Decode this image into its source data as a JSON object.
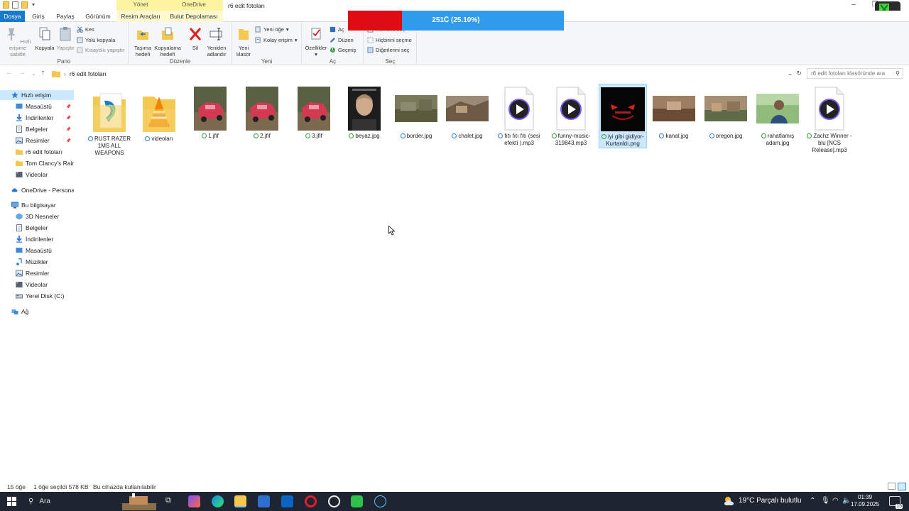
{
  "window": {
    "title": "r6 edit fotoları",
    "context_tabs": [
      "Yönet",
      "OneDrive"
    ],
    "context_sub_tabs": [
      "Resim Araçları",
      "Bulut Depolaması"
    ]
  },
  "tabs": [
    "Dosya",
    "Giriş",
    "Paylaş",
    "Görünüm"
  ],
  "ribbon": {
    "pano": {
      "label": "Pano",
      "pin": "Hızlı erişime sabitle",
      "copy": "Kopyala",
      "paste": "Yapıştır",
      "cut": "Kes",
      "copy_path": "Yolu kopyala",
      "paste_shortcut": "Kısayolu yapıştır"
    },
    "duzenle": {
      "label": "Düzenle",
      "move_to": "Taşıma hedefi",
      "copy_to": "Kopyalama hedefi",
      "delete": "Sil",
      "rename": "Yeniden adlandır"
    },
    "yeni": {
      "label": "Yeni",
      "new_folder": "Yeni klasör",
      "new_item": "Yeni öğe",
      "easy_access": "Kolay erişim"
    },
    "ac": {
      "label": "Aç",
      "properties": "Özellikler",
      "open": "Aç",
      "edit": "Düzen",
      "history": "Geçmiş"
    },
    "sec": {
      "label": "Seç",
      "select_all": "Tümünü seç",
      "select_none": "Hiçbirini seçme",
      "invert": "Diğerlerini seç"
    }
  },
  "overlay": {
    "text": "251Ꮯ (25.10%)",
    "progress": 0.251,
    "fill_color": "#e00c14",
    "bg_color": "#2f9bea"
  },
  "address": {
    "path": "r6 edit fotoları",
    "search_placeholder": "r6 edit fotoları klasöründe ara"
  },
  "nav": {
    "quick_access": "Hızlı erişim",
    "quick_items": [
      "Masaüstü",
      "İndirilenler",
      "Belgeler",
      "Resimler",
      "r6 edit fotoları",
      "Tom Clancy's Rainb",
      "Videolar"
    ],
    "onedrive": "OneDrive - Personal",
    "this_pc": "Bu bilgisayar",
    "pc_items": [
      "3D Nesneler",
      "Belgeler",
      "İndirilenler",
      "Masaüstü",
      "Müzikler",
      "Resimler",
      "Videolar",
      "Yerel Disk (C:)"
    ],
    "network": "Ağ"
  },
  "files": [
    {
      "name": "RUST RAZER 1MS ALL WEAPONS",
      "kind": "folder-app",
      "sync": "cloud"
    },
    {
      "name": "videoları",
      "kind": "folder-vlc",
      "sync": "cloud"
    },
    {
      "name": "1.jfif",
      "kind": "car",
      "sync": "ok"
    },
    {
      "name": "2.jfif",
      "kind": "car",
      "sync": "ok"
    },
    {
      "name": "3.jfif",
      "kind": "car",
      "sync": "ok"
    },
    {
      "name": "beyaz.jpg",
      "kind": "portrait",
      "sync": "ok"
    },
    {
      "name": "border.jpg",
      "kind": "landscape",
      "sync": "cloud"
    },
    {
      "name": "chalet.jpg",
      "kind": "landscape2",
      "sync": "cloud"
    },
    {
      "name": "fıtı fıtı fıtı (sesi efekti ).mp3",
      "kind": "audio",
      "sync": "cloud"
    },
    {
      "name": "funny-music-319843.mp3",
      "kind": "audio",
      "sync": "ok"
    },
    {
      "name": "iyi gibi gidiyor-Kurtanldı.png",
      "kind": "dark",
      "sync": "ok"
    },
    {
      "name": "kanal.jpg",
      "kind": "landscape3",
      "sync": "cloud"
    },
    {
      "name": "oregon.jpg",
      "kind": "landscape4",
      "sync": "cloud"
    },
    {
      "name": "rahatlamış adam.jpg",
      "kind": "man",
      "sync": "ok"
    },
    {
      "name": "Zachz Winner - blu [NCS Release].mp3",
      "kind": "audio",
      "sync": "ok"
    }
  ],
  "status": {
    "count": "15 öğe",
    "selected": "1 öğe seçildi  578 KB",
    "availability": "Bu cihazda kullanılabilir"
  },
  "taskbar": {
    "search": "Ara",
    "weather": "19°C  Parçalı bulutlu",
    "time": "01:39",
    "date": "17.09.2025",
    "notif_count": "15"
  }
}
